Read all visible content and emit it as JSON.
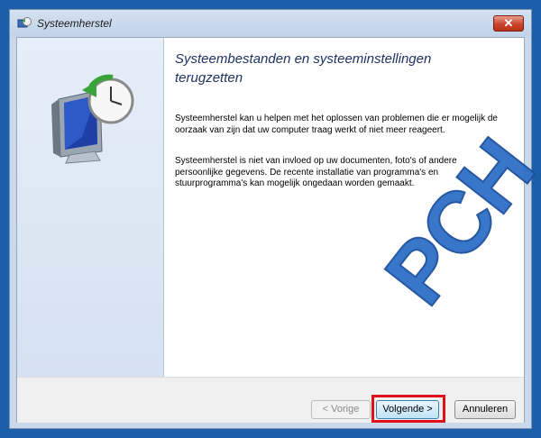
{
  "window": {
    "title": "Systeemherstel",
    "close_label": "✕"
  },
  "content": {
    "heading": "Systeembestanden en systeeminstellingen terugzetten",
    "paragraph1": "Systeemherstel kan u helpen met het oplossen van problemen die er mogelijk de oorzaak van zijn dat uw computer traag werkt of niet meer reageert.",
    "paragraph2": "Systeemherstel is niet van invloed op uw documenten, foto's of andere persoonlijke gegevens. De recente installatie van programma's en stuurprogramma's kan mogelijk ongedaan worden gemaakt."
  },
  "watermark": "PCH",
  "buttons": {
    "back": "< Vorige",
    "next": "Volgende >",
    "cancel": "Annuleren"
  },
  "colors": {
    "heading": "#1e3264",
    "highlight": "#e0101a",
    "watermark": "#2e6fc7"
  }
}
